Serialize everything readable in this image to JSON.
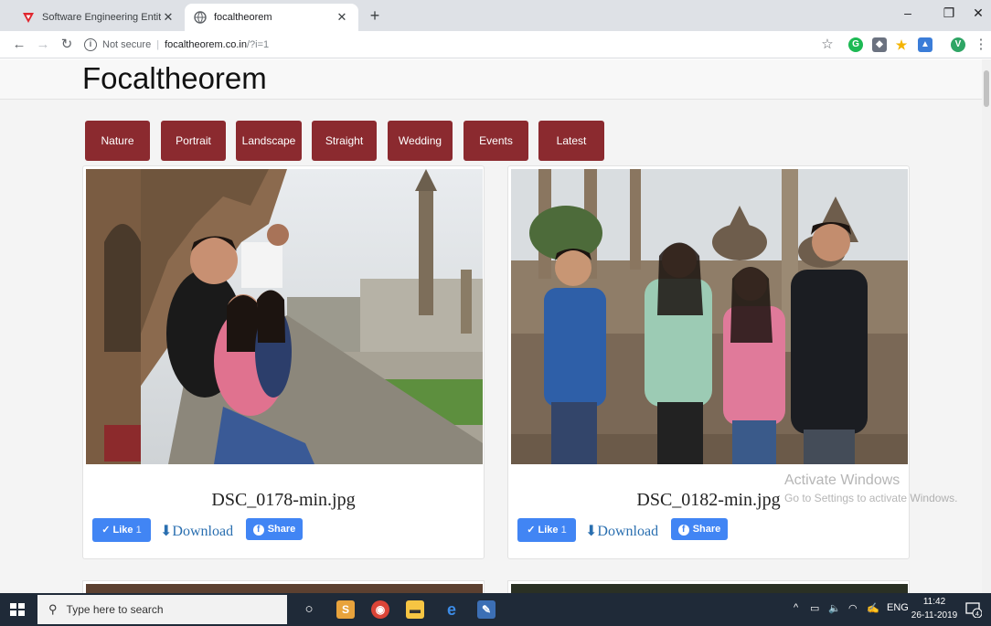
{
  "browser": {
    "tabs": [
      {
        "title": "Software Engineering Entity-Rela",
        "active": false
      },
      {
        "title": "focaltheorem",
        "active": true
      }
    ],
    "address": {
      "security": "Not secure",
      "host": "focaltheorem.co.in",
      "path": "/?i=1"
    },
    "profile_initial": "V"
  },
  "site": {
    "brand": "Focaltheorem",
    "categories": [
      "Nature",
      "Portrait",
      "Landscape",
      "Straight",
      "Wedding",
      "Events",
      "Latest"
    ],
    "photos": [
      {
        "filename": "DSC_0178-min.jpg",
        "like_label": "Like",
        "like_count": "1",
        "download_label": "Download",
        "share_label": "Share"
      },
      {
        "filename": "DSC_0182-min.jpg",
        "like_label": "Like",
        "like_count": "1",
        "download_label": "Download",
        "share_label": "Share"
      }
    ]
  },
  "watermark": {
    "line1": "Activate Windows",
    "line2": "Go to Settings to activate Windows."
  },
  "taskbar": {
    "search_placeholder": "Type here to search",
    "language": "ENG",
    "time": "11:42",
    "date": "26-11-2019",
    "notification_count": "4"
  },
  "colors": {
    "category_button": "#8b2a2f",
    "facebook_blue": "#4185f4",
    "link_blue": "#2a6fb0",
    "taskbar": "#1f2a38"
  }
}
